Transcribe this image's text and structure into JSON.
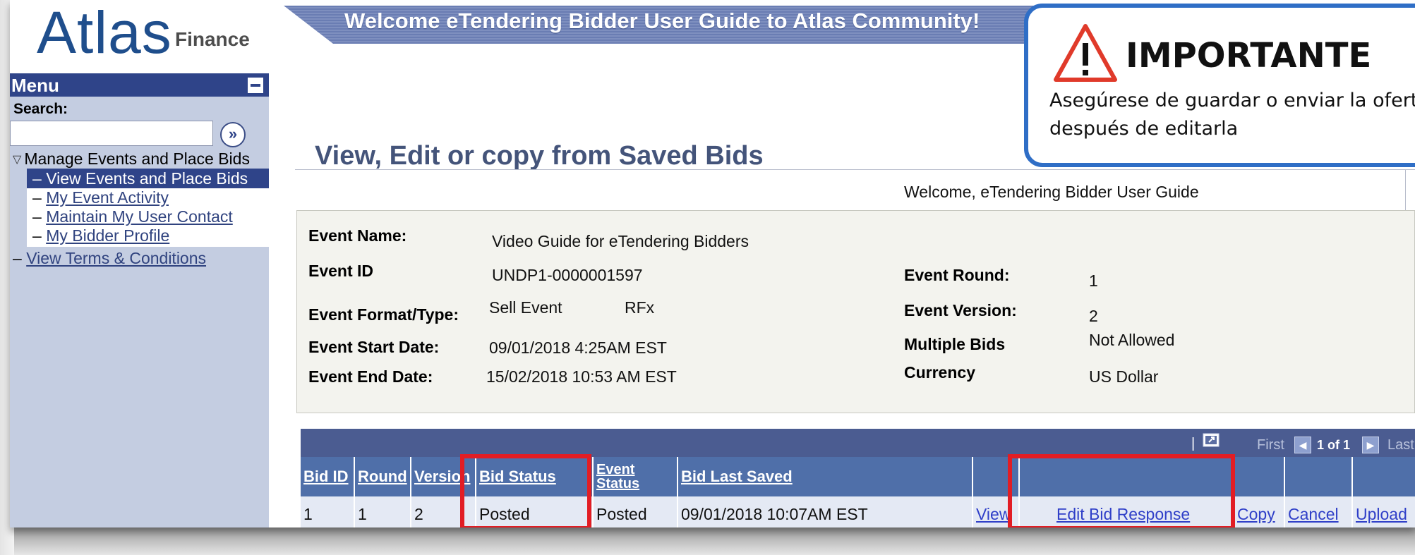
{
  "logo": {
    "main": "Atlas",
    "sub": "Finance"
  },
  "banner": {
    "text": "Welcome eTendering Bidder User Guide to Atlas Community!"
  },
  "menu": {
    "title": "Menu",
    "search_label": "Search:",
    "search_value": "",
    "search_button": "»",
    "parent": "Manage Events and Place Bids",
    "children": {
      "active": "View Events and Place Bids",
      "activity": "My Event Activity",
      "contact": "Maintain My User Contact",
      "profile": "My Bidder Profile"
    },
    "terms": "View Terms & Conditions"
  },
  "page": {
    "title": "View, Edit or copy from Saved Bids",
    "welcome": "Welcome, eTendering Bidder User Guide"
  },
  "event": {
    "name_label": "Event Name:",
    "name": "Video Guide for eTendering Bidders",
    "id_label": "Event ID",
    "id": "UNDP1-0000001597",
    "format_label": "Event Format/Type:",
    "format": "Sell Event",
    "type": "RFx",
    "start_label": "Event Start Date:",
    "start": "09/01/2018  4:25AM EST",
    "end_label": "Event End Date:",
    "end": "15/02/2018 10:53 AM EST",
    "round_label": "Event Round:",
    "round": "1",
    "version_label": "Event Version:",
    "version": "2",
    "multiple_label": "Multiple Bids",
    "multiple": "Not Allowed",
    "currency_label": "Currency",
    "currency": "US Dollar"
  },
  "grid": {
    "nav": {
      "separator": "|",
      "first": "First",
      "range": "1 of 1",
      "last": "Last"
    },
    "headers": {
      "bid_id": "Bid ID",
      "round": "Round",
      "version": "Version",
      "bid_status": "Bid Status",
      "event_status_1": "Event",
      "event_status_2": "Status",
      "bid_last_saved": "Bid Last Saved"
    },
    "row": {
      "bid_id": "1",
      "round": "1",
      "version": "2",
      "bid_status": "Posted",
      "event_status": "Posted",
      "bid_last_saved": "09/01/2018 10:07AM EST",
      "view": "View",
      "edit": "Edit Bid Response",
      "copy": "Copy",
      "cancel": "Cancel",
      "upload": "Upload"
    }
  },
  "callout": {
    "title": "IMPORTANTE",
    "text": "Asegúrese de guardar o enviar la oferta después de editarla",
    "icon": "warning-icon"
  },
  "colors": {
    "menu_bg": "#c4cde1",
    "menu_header": "#2f4489",
    "grid_header": "#4f6fa9",
    "highlight": "#e21d24",
    "callout_border": "#2f6ec6"
  }
}
